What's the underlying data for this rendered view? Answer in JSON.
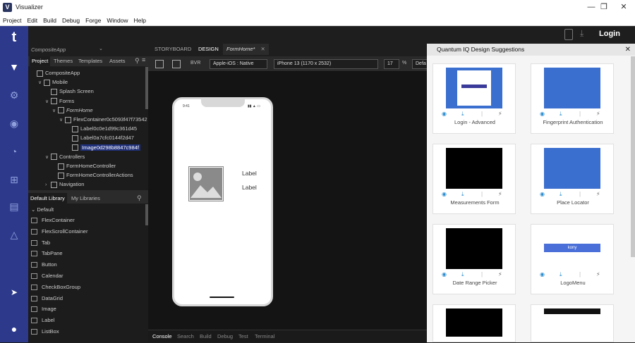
{
  "window": {
    "title": "Visualizer",
    "app_icon": "V"
  },
  "menu": [
    "Project",
    "Edit",
    "Build",
    "Debug",
    "Forge",
    "Window",
    "Help"
  ],
  "rail": {
    "logo": "t"
  },
  "header": {
    "app_name": "CompositeApp",
    "login_label": "Login"
  },
  "project_tabs": [
    "Project",
    "Themes",
    "Templates",
    "Assets"
  ],
  "tree": [
    {
      "label": "CompositeApp",
      "indent": 0,
      "arrow": ""
    },
    {
      "label": "Mobile",
      "indent": 1,
      "arrow": "v"
    },
    {
      "label": "Splash Screen",
      "indent": 2,
      "arrow": ""
    },
    {
      "label": "Forms",
      "indent": 2,
      "arrow": "v"
    },
    {
      "label": "FormHome",
      "indent": 3,
      "arrow": "v"
    },
    {
      "label": "FlexContainer0c5093f47f73542",
      "indent": 4,
      "arrow": "v"
    },
    {
      "label": "Label0c0e1d99c361d45",
      "indent": 5,
      "arrow": ""
    },
    {
      "label": "Label0a7cfc0144f2d47",
      "indent": 5,
      "arrow": ""
    },
    {
      "label": "Image0d298b8847c984f",
      "indent": 5,
      "arrow": "",
      "selected": true
    },
    {
      "label": "Controllers",
      "indent": 2,
      "arrow": "v"
    },
    {
      "label": "FormHomeController",
      "indent": 3,
      "arrow": ""
    },
    {
      "label": "FormHomeControllerActions",
      "indent": 3,
      "arrow": ""
    },
    {
      "label": "Navigation",
      "indent": 2,
      "arrow": ">"
    }
  ],
  "library": {
    "tabs": [
      "Default Library",
      "My Libraries"
    ],
    "group": "Default",
    "items": [
      "FlexContainer",
      "FlexScrollContainer",
      "Tab",
      "TabPane",
      "Button",
      "Calendar",
      "CheckBoxGroup",
      "DataGrid",
      "Image",
      "Label",
      "ListBox"
    ]
  },
  "design_tabs": [
    "STORYBOARD",
    "DESIGN",
    "FormHome*"
  ],
  "toolbar": {
    "bvr": "BVR",
    "platform": "Apple-iOS : Native",
    "device": "iPhone 13 (1170 x 2532)",
    "zoom": "17",
    "zoom_unit": "%",
    "extra": "Defa"
  },
  "phone": {
    "time": "9:41",
    "label1": "Label",
    "label2": "Label"
  },
  "bottom_tabs": [
    "Console",
    "Search",
    "Build",
    "Debug",
    "Test",
    "Terminal"
  ],
  "suggest": {
    "title": "Quantum IQ Design Suggestions",
    "cards": [
      {
        "label": "Login - Advanced"
      },
      {
        "label": "Fingerprint Authentication"
      },
      {
        "label": "Measurements Form"
      },
      {
        "label": "Place Locator"
      },
      {
        "label": "Date Range Picker"
      },
      {
        "label": "LogoMenu"
      },
      {
        "label": ""
      },
      {
        "label": ""
      }
    ],
    "logo_menu_brand": "kony"
  },
  "colors": {
    "rail": "#2d3a8c",
    "accent": "#2a8dd0",
    "selection": "#20307a"
  }
}
